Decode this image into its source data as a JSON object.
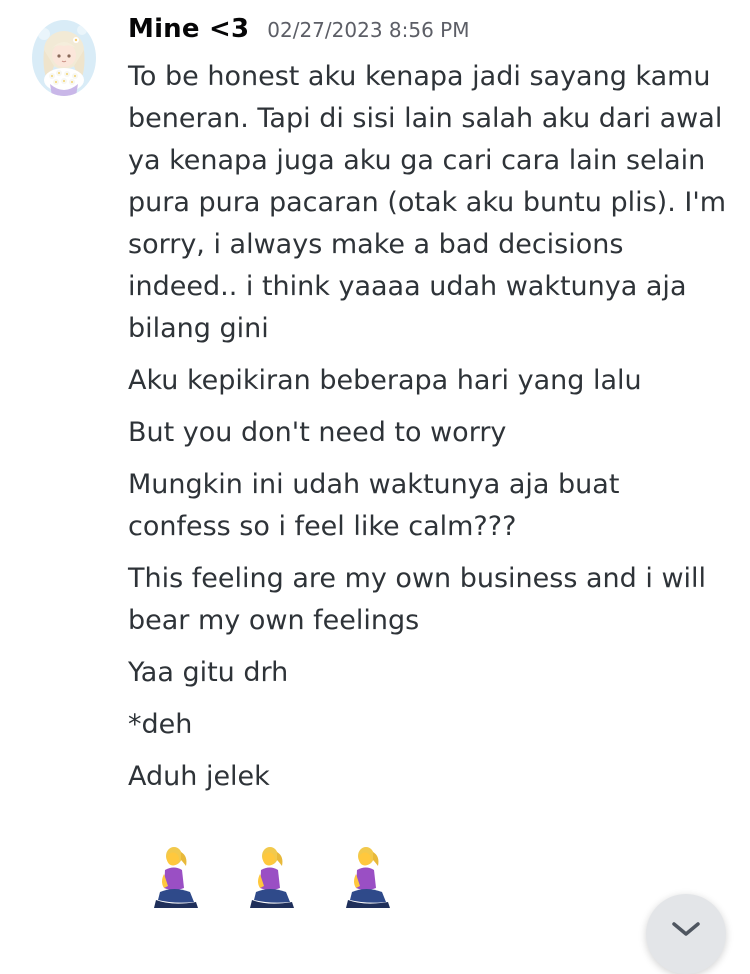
{
  "message_group": {
    "author": "Mine <3",
    "timestamp": "02/27/2023 8:56 PM",
    "avatar_icon": "anime-character-with-flowers-avatar",
    "messages": [
      "To be honest aku kenapa jadi sayang kamu beneran. Tapi di sisi lain salah aku dari awal ya kenapa juga aku ga cari cara lain selain pura pura pacaran (otak aku buntu plis). I'm sorry, i always make a bad decisions indeed.. i think yaaaa udah waktunya aja bilang gini",
      "Aku kepikiran beberapa hari yang lalu",
      "But you don't need to worry",
      "Mungkin ini udah waktunya aja buat confess so i feel like calm???",
      "This feeling are my own business and i will bear my own feelings",
      "Yaa gitu drh",
      "*deh",
      "Aduh jelek"
    ],
    "emoji_message": {
      "emojis": [
        "kneeling-woman-emoji",
        "kneeling-woman-emoji",
        "kneeling-woman-emoji"
      ]
    }
  },
  "scroll_button": {
    "icon": "chevron-down-icon"
  },
  "colors": {
    "username": "#060607",
    "timestamp": "#5c5e66",
    "text": "#2e3338",
    "background": "#ffffff"
  }
}
